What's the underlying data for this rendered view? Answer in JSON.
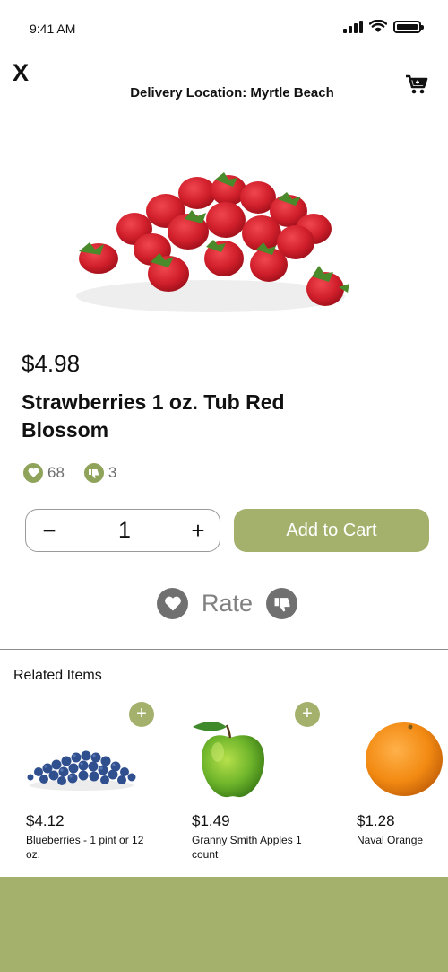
{
  "status": {
    "time": "9:41 AM"
  },
  "header": {
    "close_label": "X",
    "delivery_label": "Delivery Location: Myrtle Beach",
    "cart_icon": "cart-icon"
  },
  "product": {
    "price": "$4.98",
    "name": "Strawberries 1 oz. Tub Red Blossom",
    "likes": "68",
    "dislikes": "3",
    "image": "strawberries-image"
  },
  "quantity": {
    "minus": "−",
    "value": "1",
    "plus": "+"
  },
  "add_to_cart_label": "Add to Cart",
  "rate": {
    "label": "Rate"
  },
  "related": {
    "title": "Related Items",
    "items": [
      {
        "price": "$4.12",
        "name": "Blueberries - 1 pint or 12 oz.",
        "image": "blueberries-image"
      },
      {
        "price": "$1.49",
        "name": "Granny Smith Apples 1 count",
        "image": "green-apple-image"
      },
      {
        "price": "$1.28",
        "name": "Naval Orange",
        "image": "orange-image"
      }
    ],
    "add_symbol": "+"
  },
  "colors": {
    "accent": "#a3b16c",
    "icon_green": "#8fa35a",
    "icon_gray": "#707070"
  }
}
